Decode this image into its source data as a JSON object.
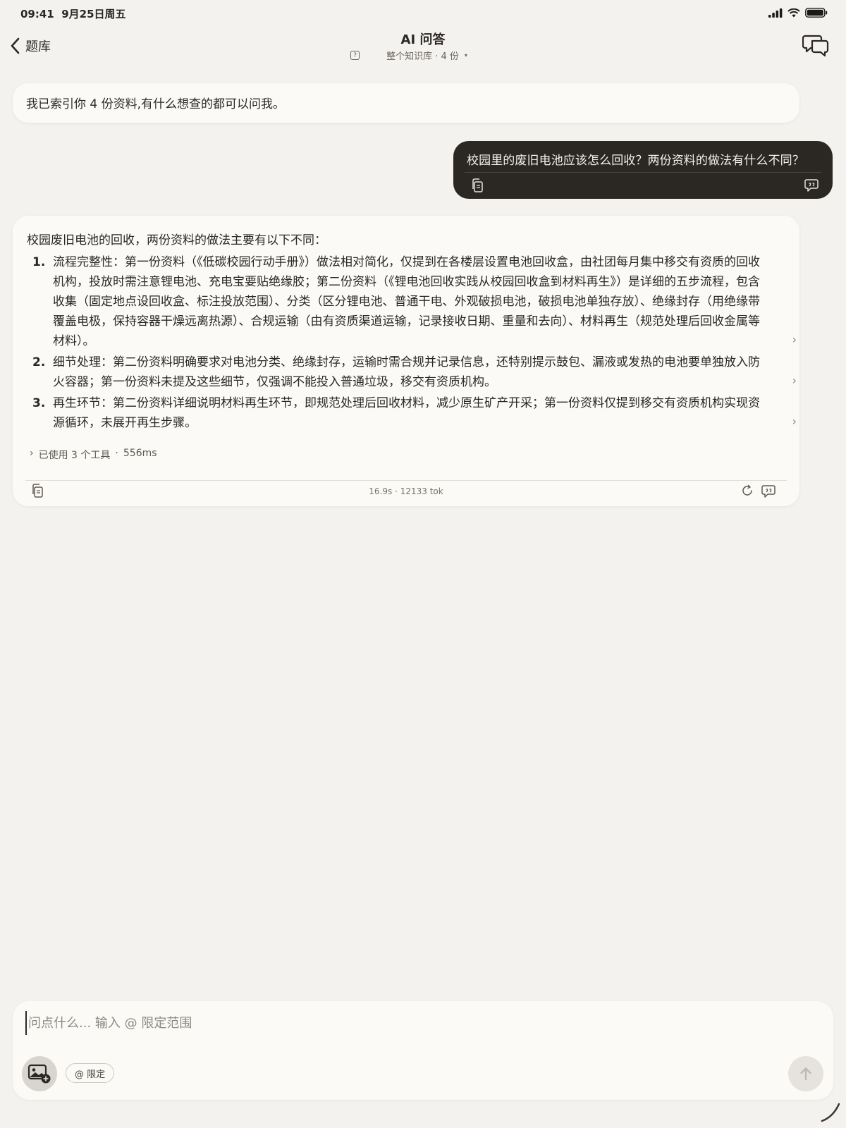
{
  "status": {
    "time": "09:41",
    "date": "9月25日周五"
  },
  "nav": {
    "back_label": "题库",
    "title": "AI 问答",
    "scope": "整个知识库 · 4 份",
    "scope_caret": "▾"
  },
  "messages": {
    "bot_intro": "我已索引你 4 份资料,有什么想查的都可以问我。",
    "user_question": "校园里的废旧电池应该怎么回收？两份资料的做法有什么不同？",
    "answer": {
      "intro": "校园废旧电池的回收，两份资料的做法主要有以下不同：",
      "items": [
        {
          "num": "1.",
          "text": "流程完整性：第一份资料（《低碳校园行动手册》）做法相对简化，仅提到在各楼层设置电池回收盒，由社团每月集中移交有资质的回收机构，投放时需注意锂电池、充电宝要贴绝缘胶；第二份资料（《锂电池回收实践从校园回收盒到材料再生》）是详细的五步流程，包含收集（固定地点设回收盒、标注投放范围）、分类（区分锂电池、普通干电、外观破损电池，破损电池单独存放）、绝缘封存（用绝缘带覆盖电极，保持容器干燥远离热源）、合规运输（由有资质渠道运输，记录接收日期、重量和去向）、材料再生（规范处理后回收金属等材料）。"
        },
        {
          "num": "2.",
          "text": "细节处理：第二份资料明确要求对电池分类、绝缘封存，运输时需合规并记录信息，还特别提示鼓包、漏液或发热的电池要单独放入防火容器；第一份资料未提及这些细节，仅强调不能投入普通垃圾，移交有资质机构。"
        },
        {
          "num": "3.",
          "text": "再生环节：第二份资料详细说明材料再生环节，即规范处理后回收材料，减少原生矿产开采；第一份资料仅提到移交有资质机构实现资源循环，未展开再生步骤。"
        }
      ],
      "item_arrow": "›",
      "tools_caret": "›",
      "tools_used": "已使用 3 个工具",
      "tools_dot": "·",
      "tools_time": "556ms",
      "meta": "16.9s · 12133 tok"
    }
  },
  "composer": {
    "placeholder": "问点什么... 输入 @ 限定范围",
    "scope_chip": "@ 限定"
  }
}
